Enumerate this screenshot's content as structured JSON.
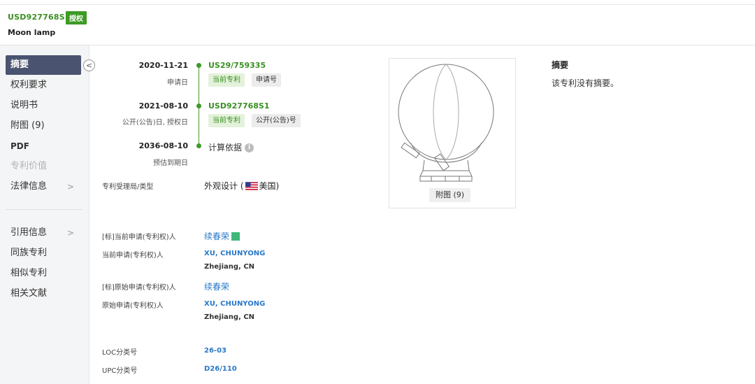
{
  "header": {
    "patent_number": "USD927768S1",
    "status": "授权",
    "title": "Moon lamp"
  },
  "sidebar": {
    "collapse_icon": "chevron-left-icon",
    "items": [
      {
        "label": "摘要",
        "state": "active"
      },
      {
        "label": "权利要求"
      },
      {
        "label": "说明书"
      },
      {
        "label": "附图 (9)"
      },
      {
        "label": "PDF"
      },
      {
        "label": "专利价值",
        "state": "disabled"
      },
      {
        "label": "法律信息",
        "chevron": "chevron-right-icon"
      },
      {
        "label": "引用信息",
        "chevron": "chevron-right-icon"
      },
      {
        "label": "同族专利"
      },
      {
        "label": "相似专利"
      },
      {
        "label": "相关文献"
      }
    ]
  },
  "timeline": {
    "application": {
      "date": "2020-11-21",
      "label": "申请日",
      "number": "US29/759335",
      "tags": [
        "当前专利",
        "申请号"
      ]
    },
    "publication": {
      "date": "2021-08-10",
      "label": "公开(公告)日, 授权日",
      "number": "USD927768S1",
      "tags": [
        "当前专利",
        "公开(公告)号"
      ]
    },
    "expiry": {
      "date": "2036-08-10",
      "label": "预估到期日",
      "note": "计算依据"
    }
  },
  "fields": {
    "office_type": {
      "label": "专利受理局/类型",
      "value": "外观设计 (",
      "country": "美国)"
    },
    "std_current_applicant": {
      "label": "[标]当前申请(专利权)人",
      "value": "续春荣"
    },
    "current_applicant": {
      "label": "当前申请(专利权)人",
      "value": "XU, CHUNYONG",
      "location": "Zhejiang, CN"
    },
    "std_original_applicant": {
      "label": "[标]原始申请(专利权)人",
      "value": "续春荣"
    },
    "original_applicant": {
      "label": "原始申请(专利权)人",
      "value": "XU, CHUNYONG",
      "location": "Zhejiang, CN"
    },
    "loc": {
      "label": "LOC分类号",
      "value": "26-03"
    },
    "upc": {
      "label": "UPC分类号",
      "value": "D26/110"
    }
  },
  "figure": {
    "caption": "附图 (9)"
  },
  "abstract": {
    "title": "摘要",
    "body": "该专利没有摘要。"
  },
  "colors": {
    "accent_green": "#3d9a25",
    "nav_active": "#4a5470",
    "link_blue": "#2a78c8"
  }
}
